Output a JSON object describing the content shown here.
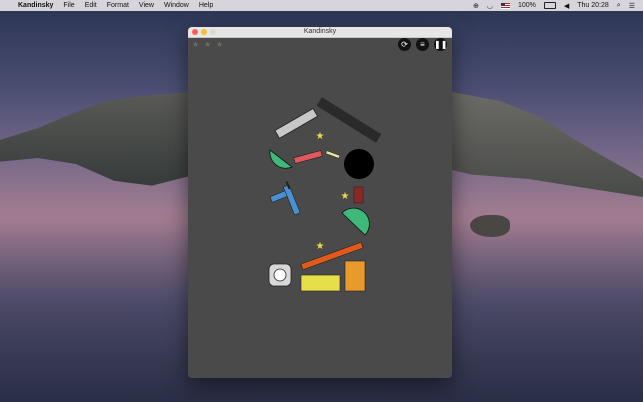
{
  "menubar": {
    "apple": "",
    "app_name": "Kandinsky",
    "menus": [
      "File",
      "Edit",
      "Format",
      "View",
      "Window",
      "Help"
    ],
    "battery_percent": "100%",
    "clock": "Thu 20:28"
  },
  "window": {
    "title": "Kandinsky",
    "stars_collected": 0,
    "stars_total": 3,
    "controls": {
      "restart_icon": "restart-icon",
      "menu_icon": "menu-icon",
      "pause_icon": "pause-icon"
    }
  },
  "colors": {
    "board_bg": "#4a4a4a",
    "green": "#3fb97a",
    "red": "#e0585d",
    "blue": "#4a8fd3",
    "orange": "#e89b2a",
    "yellow": "#e6df4a",
    "orange_red": "#df5a1c",
    "dark_red": "#8a2a26",
    "star": "#e8d84a"
  }
}
